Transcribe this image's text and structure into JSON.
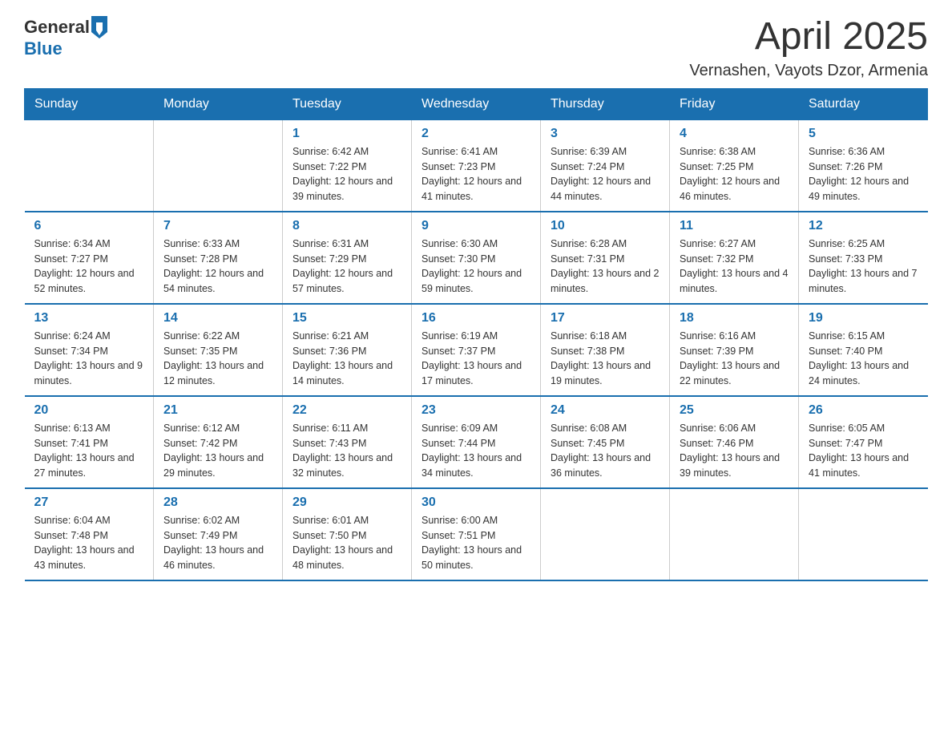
{
  "header": {
    "logo_general": "General",
    "logo_blue": "Blue",
    "title": "April 2025",
    "subtitle": "Vernashen, Vayots Dzor, Armenia"
  },
  "calendar": {
    "days_of_week": [
      "Sunday",
      "Monday",
      "Tuesday",
      "Wednesday",
      "Thursday",
      "Friday",
      "Saturday"
    ],
    "weeks": [
      [
        {
          "day": "",
          "sunrise": "",
          "sunset": "",
          "daylight": ""
        },
        {
          "day": "",
          "sunrise": "",
          "sunset": "",
          "daylight": ""
        },
        {
          "day": "1",
          "sunrise": "Sunrise: 6:42 AM",
          "sunset": "Sunset: 7:22 PM",
          "daylight": "Daylight: 12 hours and 39 minutes."
        },
        {
          "day": "2",
          "sunrise": "Sunrise: 6:41 AM",
          "sunset": "Sunset: 7:23 PM",
          "daylight": "Daylight: 12 hours and 41 minutes."
        },
        {
          "day": "3",
          "sunrise": "Sunrise: 6:39 AM",
          "sunset": "Sunset: 7:24 PM",
          "daylight": "Daylight: 12 hours and 44 minutes."
        },
        {
          "day": "4",
          "sunrise": "Sunrise: 6:38 AM",
          "sunset": "Sunset: 7:25 PM",
          "daylight": "Daylight: 12 hours and 46 minutes."
        },
        {
          "day": "5",
          "sunrise": "Sunrise: 6:36 AM",
          "sunset": "Sunset: 7:26 PM",
          "daylight": "Daylight: 12 hours and 49 minutes."
        }
      ],
      [
        {
          "day": "6",
          "sunrise": "Sunrise: 6:34 AM",
          "sunset": "Sunset: 7:27 PM",
          "daylight": "Daylight: 12 hours and 52 minutes."
        },
        {
          "day": "7",
          "sunrise": "Sunrise: 6:33 AM",
          "sunset": "Sunset: 7:28 PM",
          "daylight": "Daylight: 12 hours and 54 minutes."
        },
        {
          "day": "8",
          "sunrise": "Sunrise: 6:31 AM",
          "sunset": "Sunset: 7:29 PM",
          "daylight": "Daylight: 12 hours and 57 minutes."
        },
        {
          "day": "9",
          "sunrise": "Sunrise: 6:30 AM",
          "sunset": "Sunset: 7:30 PM",
          "daylight": "Daylight: 12 hours and 59 minutes."
        },
        {
          "day": "10",
          "sunrise": "Sunrise: 6:28 AM",
          "sunset": "Sunset: 7:31 PM",
          "daylight": "Daylight: 13 hours and 2 minutes."
        },
        {
          "day": "11",
          "sunrise": "Sunrise: 6:27 AM",
          "sunset": "Sunset: 7:32 PM",
          "daylight": "Daylight: 13 hours and 4 minutes."
        },
        {
          "day": "12",
          "sunrise": "Sunrise: 6:25 AM",
          "sunset": "Sunset: 7:33 PM",
          "daylight": "Daylight: 13 hours and 7 minutes."
        }
      ],
      [
        {
          "day": "13",
          "sunrise": "Sunrise: 6:24 AM",
          "sunset": "Sunset: 7:34 PM",
          "daylight": "Daylight: 13 hours and 9 minutes."
        },
        {
          "day": "14",
          "sunrise": "Sunrise: 6:22 AM",
          "sunset": "Sunset: 7:35 PM",
          "daylight": "Daylight: 13 hours and 12 minutes."
        },
        {
          "day": "15",
          "sunrise": "Sunrise: 6:21 AM",
          "sunset": "Sunset: 7:36 PM",
          "daylight": "Daylight: 13 hours and 14 minutes."
        },
        {
          "day": "16",
          "sunrise": "Sunrise: 6:19 AM",
          "sunset": "Sunset: 7:37 PM",
          "daylight": "Daylight: 13 hours and 17 minutes."
        },
        {
          "day": "17",
          "sunrise": "Sunrise: 6:18 AM",
          "sunset": "Sunset: 7:38 PM",
          "daylight": "Daylight: 13 hours and 19 minutes."
        },
        {
          "day": "18",
          "sunrise": "Sunrise: 6:16 AM",
          "sunset": "Sunset: 7:39 PM",
          "daylight": "Daylight: 13 hours and 22 minutes."
        },
        {
          "day": "19",
          "sunrise": "Sunrise: 6:15 AM",
          "sunset": "Sunset: 7:40 PM",
          "daylight": "Daylight: 13 hours and 24 minutes."
        }
      ],
      [
        {
          "day": "20",
          "sunrise": "Sunrise: 6:13 AM",
          "sunset": "Sunset: 7:41 PM",
          "daylight": "Daylight: 13 hours and 27 minutes."
        },
        {
          "day": "21",
          "sunrise": "Sunrise: 6:12 AM",
          "sunset": "Sunset: 7:42 PM",
          "daylight": "Daylight: 13 hours and 29 minutes."
        },
        {
          "day": "22",
          "sunrise": "Sunrise: 6:11 AM",
          "sunset": "Sunset: 7:43 PM",
          "daylight": "Daylight: 13 hours and 32 minutes."
        },
        {
          "day": "23",
          "sunrise": "Sunrise: 6:09 AM",
          "sunset": "Sunset: 7:44 PM",
          "daylight": "Daylight: 13 hours and 34 minutes."
        },
        {
          "day": "24",
          "sunrise": "Sunrise: 6:08 AM",
          "sunset": "Sunset: 7:45 PM",
          "daylight": "Daylight: 13 hours and 36 minutes."
        },
        {
          "day": "25",
          "sunrise": "Sunrise: 6:06 AM",
          "sunset": "Sunset: 7:46 PM",
          "daylight": "Daylight: 13 hours and 39 minutes."
        },
        {
          "day": "26",
          "sunrise": "Sunrise: 6:05 AM",
          "sunset": "Sunset: 7:47 PM",
          "daylight": "Daylight: 13 hours and 41 minutes."
        }
      ],
      [
        {
          "day": "27",
          "sunrise": "Sunrise: 6:04 AM",
          "sunset": "Sunset: 7:48 PM",
          "daylight": "Daylight: 13 hours and 43 minutes."
        },
        {
          "day": "28",
          "sunrise": "Sunrise: 6:02 AM",
          "sunset": "Sunset: 7:49 PM",
          "daylight": "Daylight: 13 hours and 46 minutes."
        },
        {
          "day": "29",
          "sunrise": "Sunrise: 6:01 AM",
          "sunset": "Sunset: 7:50 PM",
          "daylight": "Daylight: 13 hours and 48 minutes."
        },
        {
          "day": "30",
          "sunrise": "Sunrise: 6:00 AM",
          "sunset": "Sunset: 7:51 PM",
          "daylight": "Daylight: 13 hours and 50 minutes."
        },
        {
          "day": "",
          "sunrise": "",
          "sunset": "",
          "daylight": ""
        },
        {
          "day": "",
          "sunrise": "",
          "sunset": "",
          "daylight": ""
        },
        {
          "day": "",
          "sunrise": "",
          "sunset": "",
          "daylight": ""
        }
      ]
    ]
  }
}
